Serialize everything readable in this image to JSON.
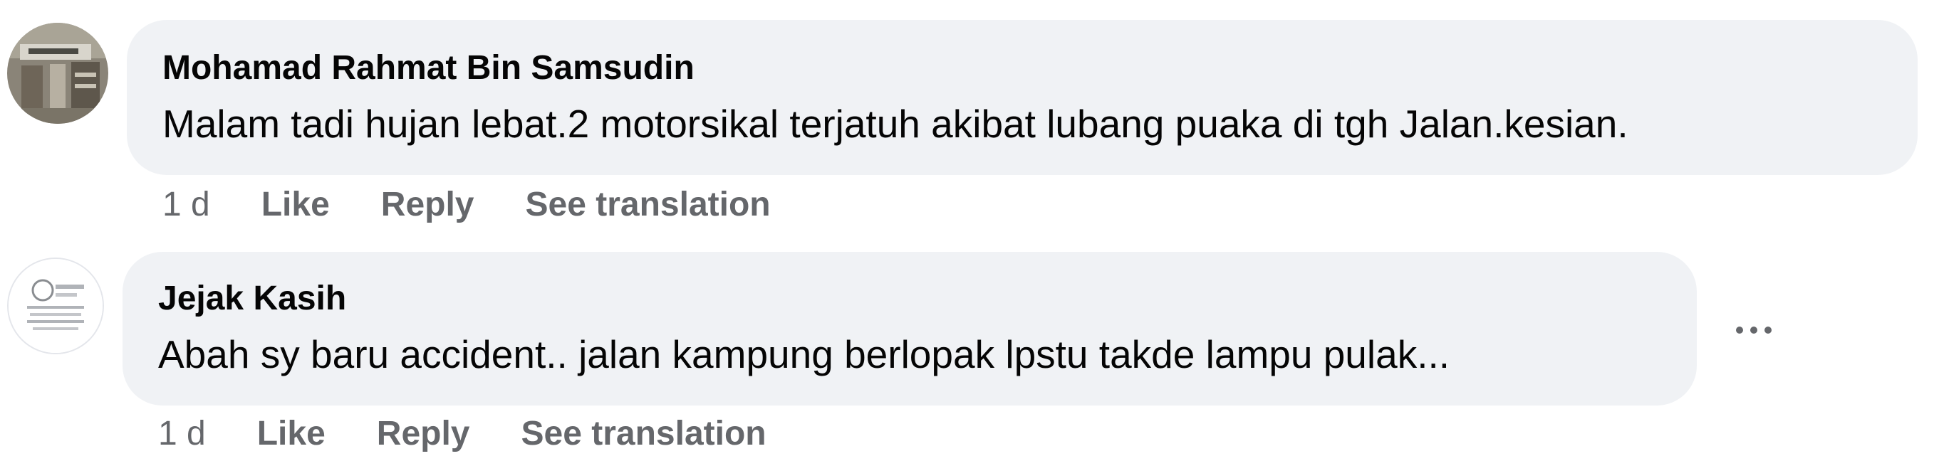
{
  "comments": [
    {
      "author": "Mohamad Rahmat Bin Samsudin",
      "text": "Malam tadi hujan lebat.2 motorsikal terjatuh akibat lubang puaka di tgh Jalan.kesian.",
      "time": "1 d",
      "like_label": "Like",
      "reply_label": "Reply",
      "translate_label": "See translation",
      "avatar_icon": "profile-photo-icon"
    },
    {
      "author": "Jejak Kasih",
      "text": "Abah sy baru accident.. jalan kampung berlopak lpstu takde lampu pulak...",
      "time": "1 d",
      "like_label": "Like",
      "reply_label": "Reply",
      "translate_label": "See translation",
      "avatar_icon": "page-logo-icon",
      "more_icon": "more-options-icon"
    }
  ],
  "colors": {
    "bubble": "#f0f2f5",
    "text": "#050505",
    "secondary": "#65676b"
  }
}
